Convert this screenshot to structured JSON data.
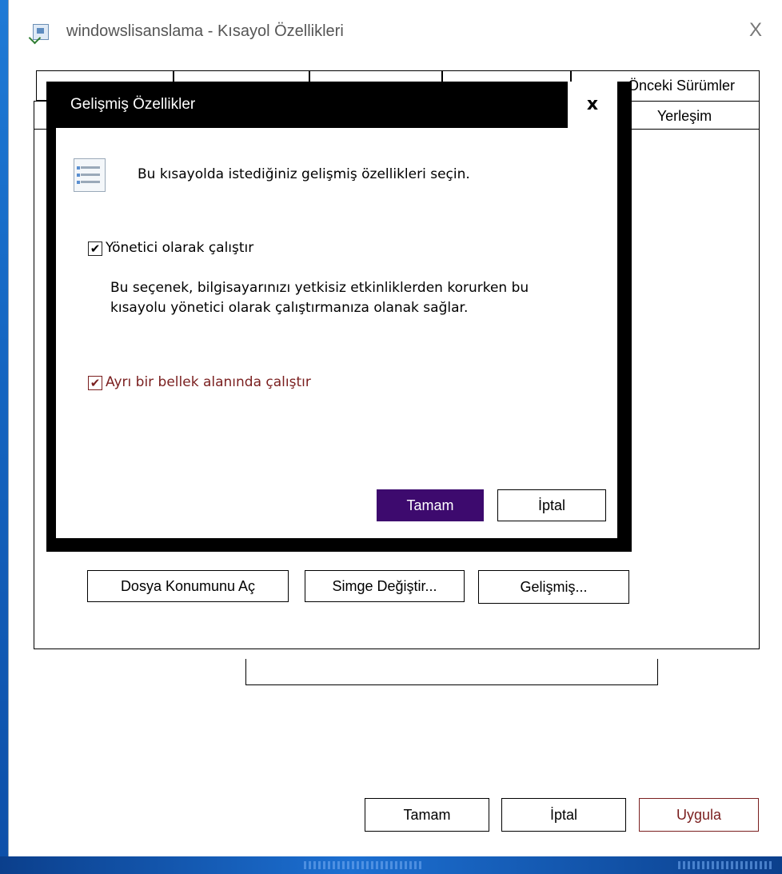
{
  "window": {
    "title": "windowslisanslama - Kısayol Özellikleri",
    "close_glyph": "X"
  },
  "tabs": {
    "previous_versions": "Önceki Sürümler",
    "layout": "Yerleşim"
  },
  "panel_buttons": {
    "open_location": "Dosya Konumunu Aç",
    "change_icon": "Simge Değiştir...",
    "advanced": "Gelişmiş..."
  },
  "footer_buttons": {
    "ok": "Tamam",
    "cancel": "İptal",
    "apply": "Uygula"
  },
  "dialog": {
    "title": "Gelişmiş Özellikler",
    "close_glyph": "x",
    "intro": "Bu kısayolda istediğiniz gelişmiş özellikleri seçin.",
    "run_as_admin": {
      "label": "Yönetici olarak çalıştır",
      "checked": true
    },
    "description_line1": "Bu seçenek, bilgisayarınızı yetkisiz etkinliklerden korurken bu",
    "description_line2": "kısayolu yönetici olarak çalıştırmanıza olanak sağlar.",
    "separate_memory": {
      "label": "Ayrı bir bellek alanında çalıştır",
      "checked": true
    },
    "ok": "Tamam",
    "cancel": "İptal"
  },
  "colors": {
    "ok_button": "#3d0a6e",
    "apply_text": "#7a1f1f",
    "dialog_frame": "#000000"
  }
}
